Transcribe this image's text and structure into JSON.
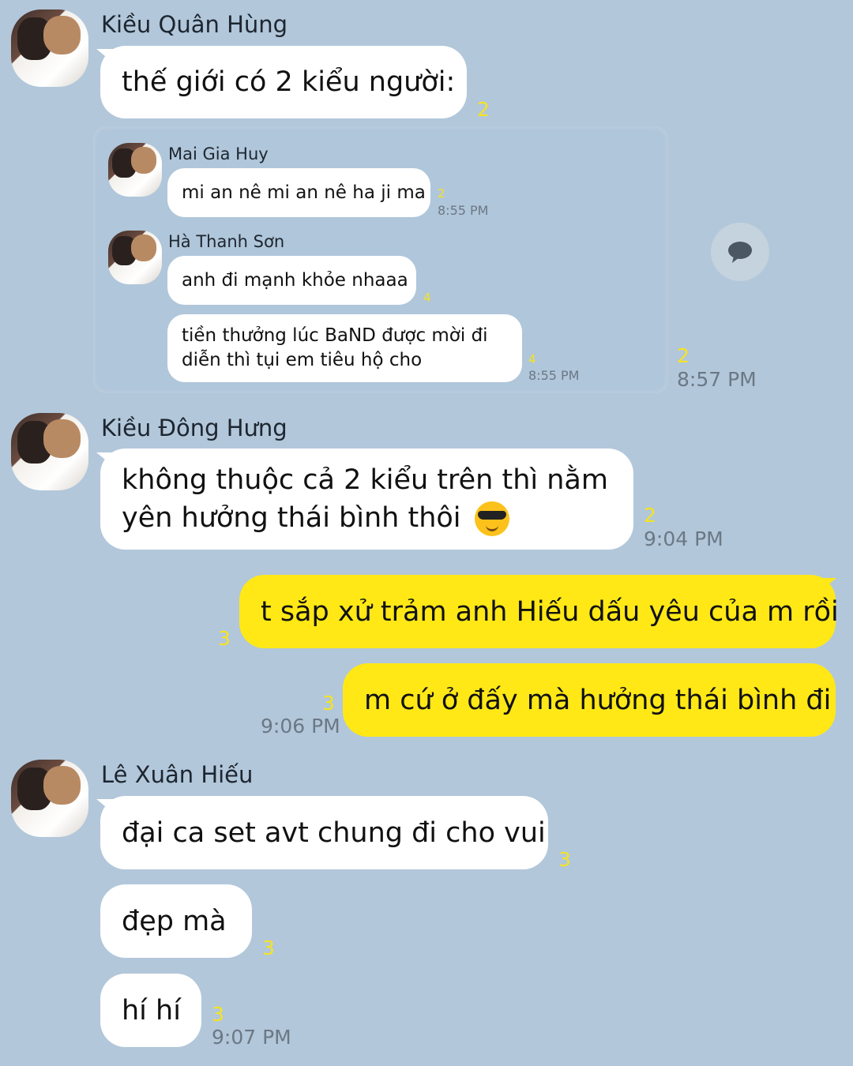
{
  "messages": {
    "m1": {
      "sender": "Kiều Quân Hùng",
      "text": "thế giới có 2 kiểu người:",
      "read": "2"
    },
    "quote": {
      "q1": {
        "sender": "Mai Gia Huy",
        "text": "mi an nê mi an nê ha ji ma",
        "read": "2",
        "time": "8:55 PM"
      },
      "q2": {
        "sender": "Hà Thanh Sơn",
        "text1": "anh đi mạnh khỏe nhaaa",
        "read1": "4",
        "text2_line1": "tiền thưởng lúc BaND được mời đi",
        "text2_line2": "diễn thì tụi em tiêu hộ cho",
        "read2": "4",
        "time": "8:55 PM"
      },
      "read": "2",
      "time": "8:57 PM"
    },
    "m2": {
      "sender": "Kiều Đông Hưng",
      "line1": "không thuộc cả 2 kiểu trên thì nằm",
      "line2": "yên hưởng thái bình thôi",
      "read": "2",
      "time": "9:04 PM"
    },
    "m3": {
      "text": "t sắp xử trảm anh Hiếu dấu yêu của m rồi",
      "read": "3"
    },
    "m4": {
      "text": "m cứ ở đấy mà hưởng thái bình đi",
      "read": "3",
      "time": "9:06 PM"
    },
    "m5": {
      "sender": "Lê Xuân Hiếu",
      "text1": "đại ca set avt chung đi cho vui",
      "read1": "3",
      "text2": "đẹp mà",
      "read2": "3",
      "text3": "hí hí",
      "read3": "3",
      "time": "9:07 PM"
    }
  },
  "icons": {
    "share": "chat-bubble-icon",
    "emoji": "sunglasses-emoji-icon"
  },
  "colors": {
    "background": "#b2c7da",
    "my_bubble": "#ffe816",
    "their_bubble": "#ffffff",
    "read_count": "#f5e323"
  }
}
